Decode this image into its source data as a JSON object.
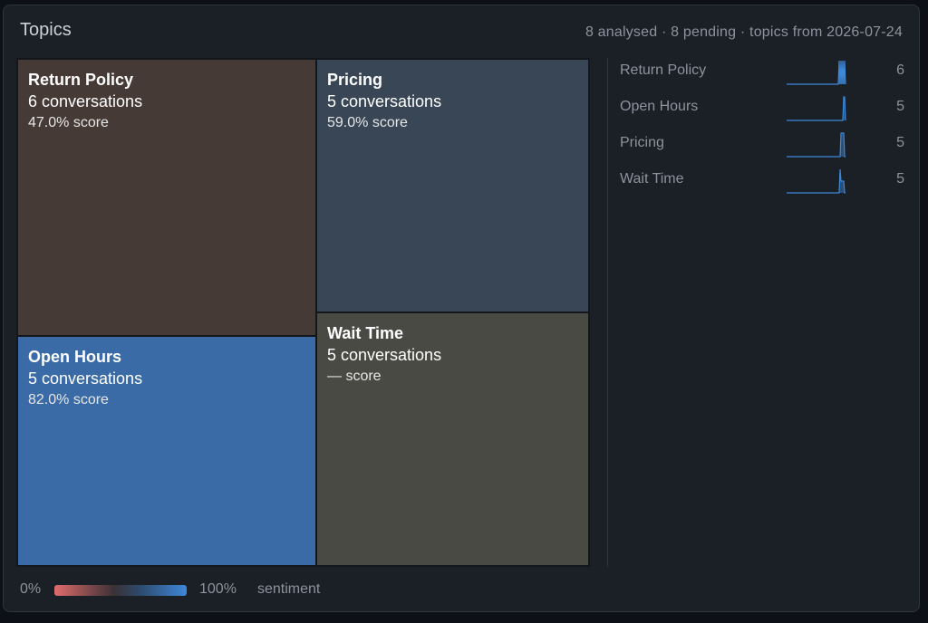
{
  "header": {
    "title": "Topics",
    "summary": "8 analysed · 8 pending · topics from 2026-07-24"
  },
  "tiles": [
    {
      "name": "Return Policy",
      "count": "6 conversations",
      "score": "47.0% score",
      "sentiment": 0.47,
      "color": "#463a36"
    },
    {
      "name": "Pricing",
      "count": "5 conversations",
      "score": "59.0% score",
      "sentiment": 0.59,
      "color": "#384656"
    },
    {
      "name": "Open Hours",
      "count": "5 conversations",
      "score": "82.0% score",
      "sentiment": 0.82,
      "color": "#3a6ba6"
    },
    {
      "name": "Wait Time",
      "count": "5 conversations",
      "score": "— score",
      "sentiment": null,
      "color": "#4a4a45"
    }
  ],
  "ranking": [
    {
      "label": "Return Policy",
      "count": "6",
      "spark": [
        0,
        0,
        0,
        0,
        0,
        0,
        0,
        0,
        0,
        0,
        0,
        0,
        0,
        0,
        0,
        0,
        0,
        0,
        0,
        0,
        0,
        0,
        0,
        0,
        0,
        0,
        0,
        0,
        0,
        0,
        0,
        0,
        0,
        0,
        0,
        0,
        0,
        0,
        0,
        0,
        0,
        0,
        0,
        0,
        0,
        0,
        0,
        0,
        0,
        0,
        0,
        0,
        0,
        0,
        0,
        0,
        0,
        0,
        1,
        0,
        1,
        0,
        1,
        0,
        1,
        0
      ]
    },
    {
      "label": "Open Hours",
      "count": "5",
      "spark": [
        0,
        0,
        0,
        0,
        0,
        0,
        0,
        0,
        0,
        0,
        0,
        0,
        0,
        0,
        0,
        0,
        0,
        0,
        0,
        0,
        0,
        0,
        0,
        0,
        0,
        0,
        0,
        0,
        0,
        0,
        0,
        0,
        0,
        0,
        0,
        0,
        0,
        0,
        0,
        0,
        0,
        0,
        0,
        0,
        0,
        0,
        0,
        0,
        0,
        0,
        0,
        0,
        0,
        0,
        0,
        0,
        0,
        0,
        0,
        0,
        0,
        0,
        0,
        1,
        1,
        0
      ]
    },
    {
      "label": "Pricing",
      "count": "5",
      "spark": [
        0,
        0,
        0,
        0,
        0,
        0,
        0,
        0,
        0,
        0,
        0,
        0,
        0,
        0,
        0,
        0,
        0,
        0,
        0,
        0,
        0,
        0,
        0,
        0,
        0,
        0,
        0,
        0,
        0,
        0,
        0,
        0,
        0,
        0,
        0,
        0,
        0,
        0,
        0,
        0,
        0,
        0,
        0,
        0,
        0,
        0,
        0,
        0,
        0,
        0,
        0,
        0,
        0,
        0,
        0,
        0,
        0,
        0,
        0,
        0,
        1,
        1,
        1,
        1,
        0,
        0
      ]
    },
    {
      "label": "Wait Time",
      "count": "5",
      "spark": [
        0,
        0,
        0,
        0,
        0,
        0,
        0,
        0,
        0,
        0,
        0,
        0,
        0,
        0,
        0,
        0,
        0,
        0,
        0,
        0,
        0,
        0,
        0,
        0,
        0,
        0,
        0,
        0,
        0,
        0,
        0,
        0,
        0,
        0,
        0,
        0,
        0,
        0,
        0,
        0,
        0,
        0,
        0,
        0,
        0,
        0,
        0,
        0,
        0,
        0,
        0,
        0,
        0,
        0,
        0,
        0,
        0,
        0,
        0,
        1,
        0.5,
        0.5,
        0.5,
        0.5,
        0,
        0
      ]
    }
  ],
  "legend": {
    "min": "0%",
    "max": "100%",
    "label": "sentiment"
  },
  "colors": {
    "accent": "#3e88d8",
    "negative": "#e06c6c"
  }
}
